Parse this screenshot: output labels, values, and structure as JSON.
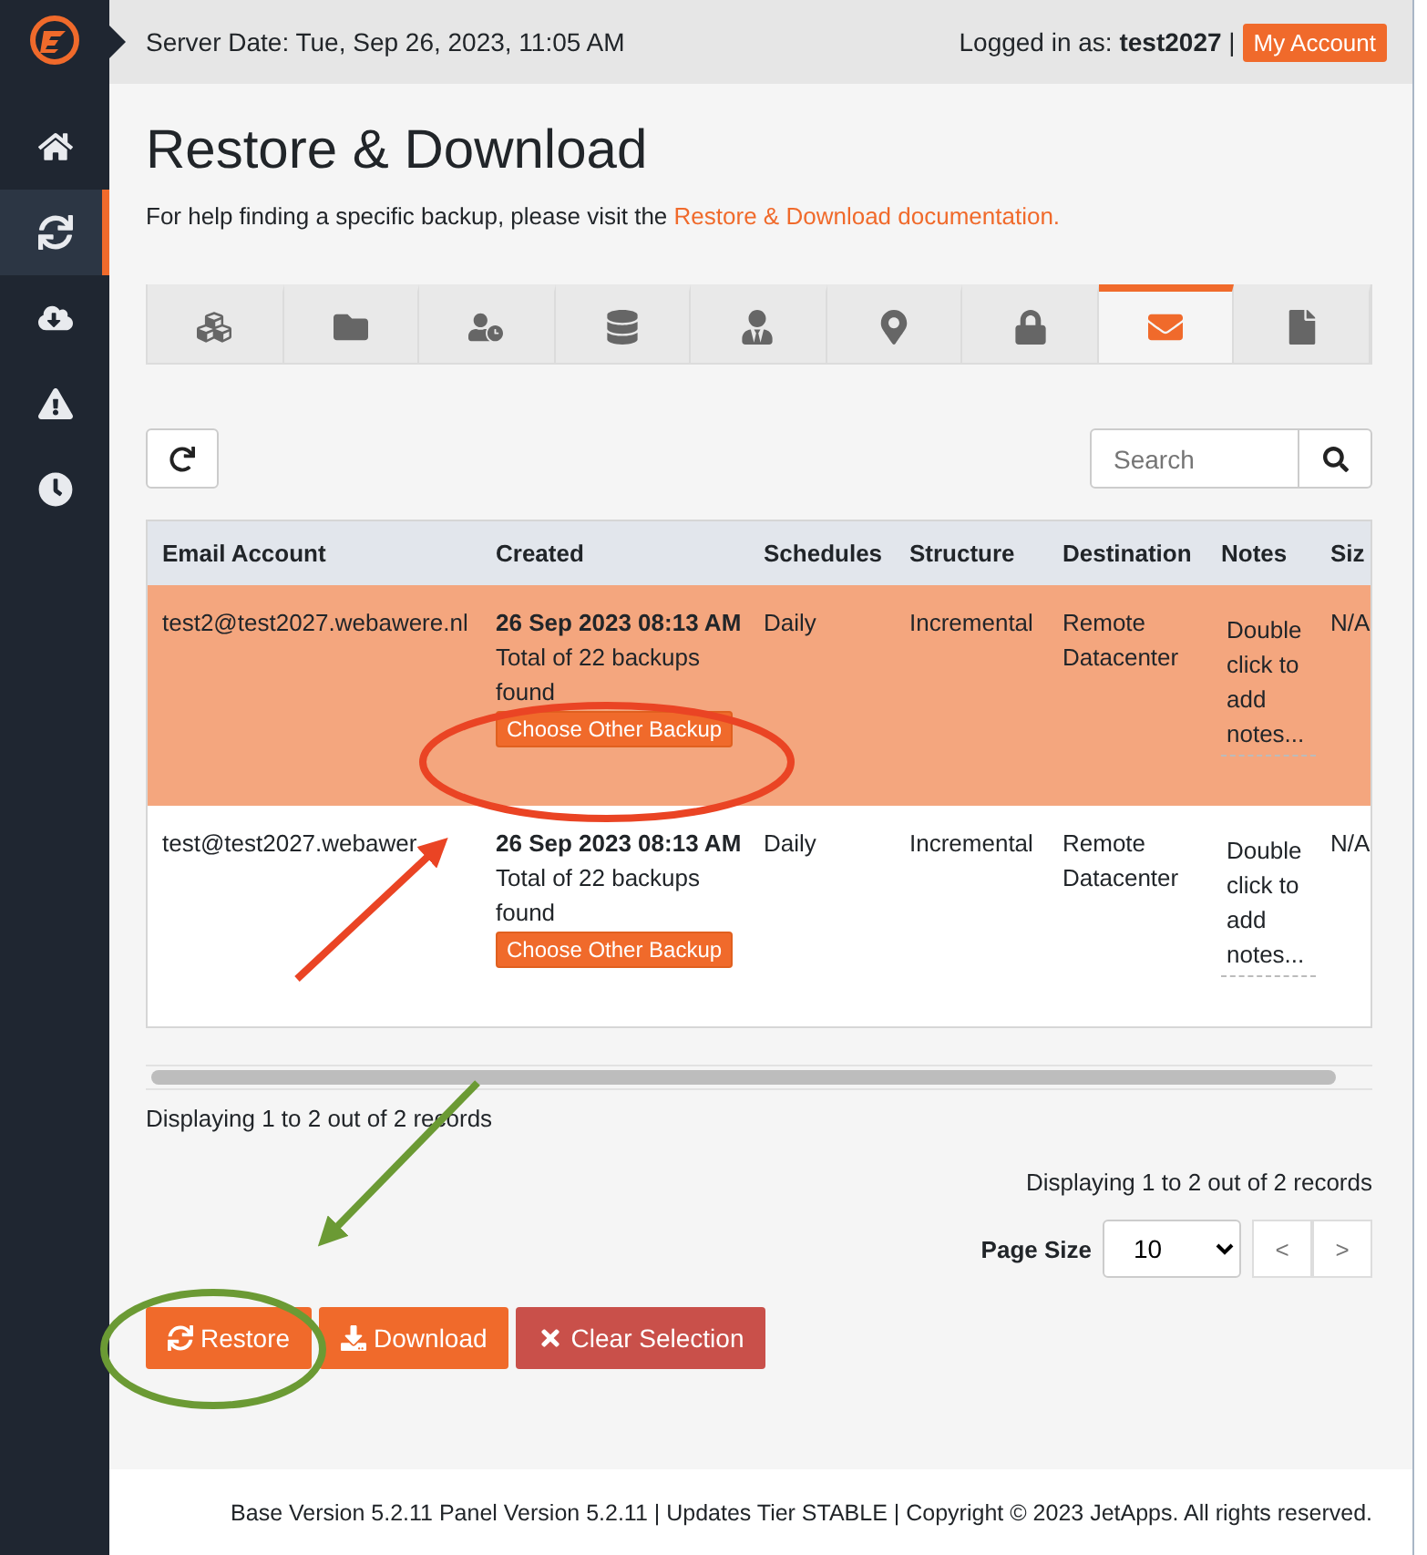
{
  "sidebar": {
    "items": [
      {
        "selected": false
      },
      {
        "selected": true
      },
      {
        "selected": false
      },
      {
        "selected": false
      },
      {
        "selected": false
      }
    ]
  },
  "header": {
    "server_date": "Server Date: Tue, Sep 26, 2023, 11:05 AM",
    "logged_in": "Logged in as: **test2027** |",
    "account_button": "My Account"
  },
  "page": {
    "title": "Restore & Download",
    "help_text": "For help finding a specific backup, please visit the",
    "help_link": "Restore & Download documentation."
  },
  "tabs": [
    {
      "selected": false
    },
    {
      "selected": false
    },
    {
      "selected": false
    },
    {
      "selected": false
    },
    {
      "selected": false
    },
    {
      "selected": false
    },
    {
      "selected": false
    },
    {
      "selected": true
    },
    {
      "selected": false
    }
  ],
  "search": {
    "placeholder": "Search"
  },
  "table": {
    "columns": [
      "Email Account",
      "Created",
      "Schedules",
      "Structure",
      "Destination",
      "Notes",
      "Siz"
    ],
    "rows": [
      {
        "selected": true,
        "email": "test2@test2027.webawere.nl",
        "created": "26 Sep 2023 08:13 AM",
        "backups": "Total of 22 backups found",
        "choose_button": "Choose Other Backup",
        "schedule": "Daily",
        "structure": "Incremental",
        "destination": "Remote Datacenter",
        "notes": "Double click to add notes...",
        "size": "N/A"
      },
      {
        "selected": false,
        "email": "test@test2027.webawer",
        "created": "26 Sep 2023 08:13 AM",
        "backups": "Total of 22 backups found",
        "choose_button": "Choose Other Backup",
        "schedule": "Daily",
        "structure": "Incremental",
        "destination": "Remote Datacenter",
        "notes": "Double click to add notes...",
        "size": "N/A"
      }
    ]
  },
  "records_top": "Displaying 1 to 2 out of 2 records",
  "records_bottom": "Displaying 1 to 2 out of 2 records",
  "pager": {
    "label": "Page Size",
    "page_size": "10",
    "prev": "<",
    "next": ">"
  },
  "actions": [
    {
      "kind": "restore",
      "label": "Restore"
    },
    {
      "kind": "download",
      "label": "Download"
    },
    {
      "kind": "clear",
      "label": "Clear Selection"
    }
  ],
  "footer": "Base Version 5.2.11 Panel Version 5.2.11 | Updates Tier STABLE | Copyright © 2023 JetApps. All rights reserved."
}
